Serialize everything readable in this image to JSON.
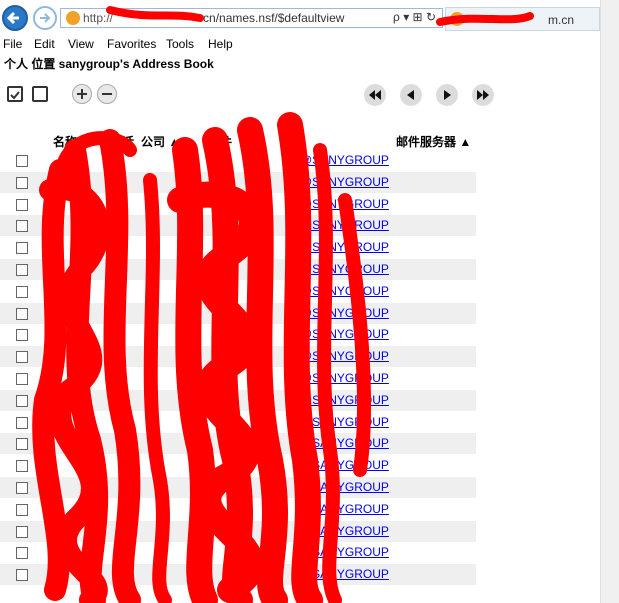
{
  "browser": {
    "url_prefix": "http://",
    "url_suffix": "cn/names.nsf/$defaultview",
    "url_tools": "ρ ▾ ⊞ ↻",
    "tab_title": "m.cn"
  },
  "menu": [
    "File",
    "Edit",
    "View",
    "Favorites",
    "Tools",
    "Help"
  ],
  "page": {
    "title": "个人 位置 sanygroup's Address Book"
  },
  "columns": {
    "name": "名称▲",
    "phone": "电话",
    "company": "公司 ▲",
    "email": "邮件",
    "mail_server": "邮件服务器 ▲"
  },
  "rows": [
    "@SANYGROUP",
    "@SANYGROUP",
    "@SANYGROUP",
    "@SANYGROUP",
    "@SANYGROUP",
    "@SANYGROUP",
    "@SANYGROUP",
    "@SANYGROUP",
    "@SANYGROUP",
    "@SANYGROUP",
    "@SANYGROUP",
    "@SANYGROUP",
    "@SANYGROUP",
    "@SANYGROUP",
    "@SANYGROUP",
    "@SANYGROUP",
    "@SANYGROUP",
    "@SANYGROUP",
    "@SANYGROUP",
    "@SANYGROUP"
  ],
  "colors": {
    "redaction": "#ff0000",
    "link": "#0000ee",
    "stripe": "#efefef"
  }
}
